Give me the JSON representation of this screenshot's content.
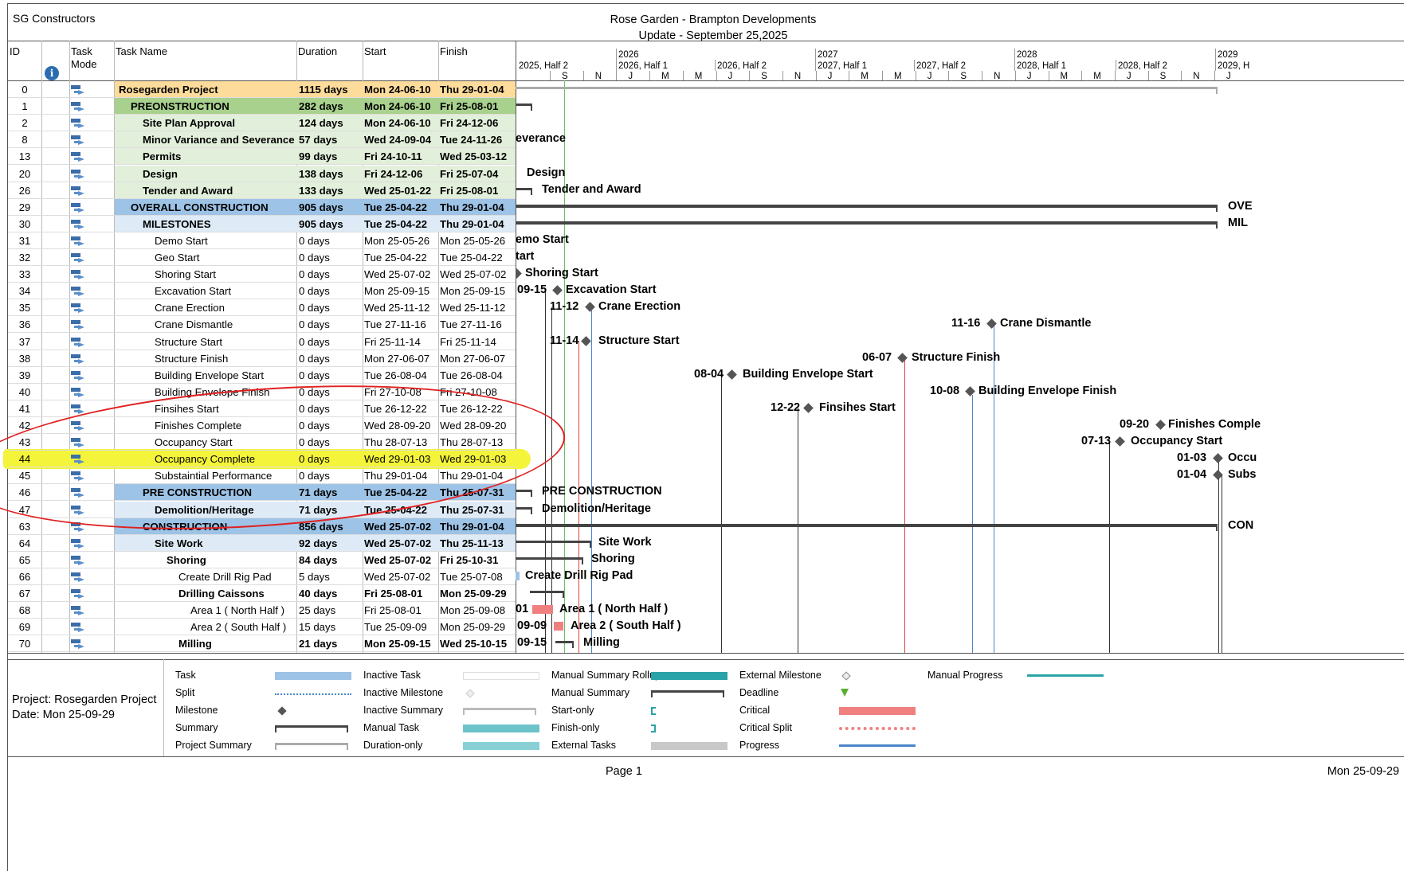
{
  "header": {
    "company": "SG Constructors",
    "title_line1": "Rose Garden - Brampton Developments",
    "title_line2": "Update - September 25,2025"
  },
  "columns": {
    "id": "ID",
    "indicator_icon": "info-icon",
    "task_mode_1": "Task",
    "task_mode_2": "Mode",
    "task_name": "Task Name",
    "duration": "Duration",
    "start": "Start",
    "finish": "Finish"
  },
  "timescale": {
    "years": [
      "2026",
      "2027",
      "2028",
      "2029"
    ],
    "halves": [
      "2025, Half 2",
      "2026, Half 1",
      "2026, Half 2",
      "2027, Half 1",
      "2027, Half 2",
      "2028, Half 1",
      "2028, Half 2",
      "2029, H"
    ],
    "months": [
      "S",
      "N",
      "J",
      "M",
      "M",
      "J",
      "S",
      "N",
      "J",
      "M",
      "M",
      "J",
      "S",
      "N",
      "J",
      "M",
      "M",
      "J",
      "S",
      "N",
      "J"
    ]
  },
  "rows": [
    {
      "id": "0",
      "name": "Rosegarden Project",
      "duration": "1115 days",
      "start": "Mon 24-06-10",
      "finish": "Thu 29-01-04",
      "bold": true,
      "indent": 0,
      "color": "#fddc9b"
    },
    {
      "id": "1",
      "name": "PREONSTRUCTION",
      "duration": "282 days",
      "start": "Mon 24-06-10",
      "finish": "Fri 25-08-01",
      "bold": true,
      "indent": 1,
      "color": "#a9d18e"
    },
    {
      "id": "2",
      "name": "Site Plan Approval",
      "duration": "124 days",
      "start": "Mon 24-06-10",
      "finish": "Fri 24-12-06",
      "bold": true,
      "indent": 2,
      "color": "#e2efda"
    },
    {
      "id": "8",
      "name": "Minor Variance and Severance",
      "duration": "57 days",
      "start": "Wed 24-09-04",
      "finish": "Tue 24-11-26",
      "bold": true,
      "indent": 2,
      "color": "#e2efda"
    },
    {
      "id": "13",
      "name": "Permits",
      "duration": "99 days",
      "start": "Fri 24-10-11",
      "finish": "Wed 25-03-12",
      "bold": true,
      "indent": 2,
      "color": "#e2efda"
    },
    {
      "id": "20",
      "name": "Design",
      "duration": "138 days",
      "start": "Fri 24-12-06",
      "finish": "Fri 25-07-04",
      "bold": true,
      "indent": 2,
      "color": "#e2efda"
    },
    {
      "id": "26",
      "name": "Tender and Award",
      "duration": "133 days",
      "start": "Wed 25-01-22",
      "finish": "Fri 25-08-01",
      "bold": true,
      "indent": 2,
      "color": "#e2efda"
    },
    {
      "id": "29",
      "name": "OVERALL CONSTRUCTION",
      "duration": "905 days",
      "start": "Tue 25-04-22",
      "finish": "Thu 29-01-04",
      "bold": true,
      "indent": 1,
      "color": "#9dc3e6"
    },
    {
      "id": "30",
      "name": "MILESTONES",
      "duration": "905 days",
      "start": "Tue 25-04-22",
      "finish": "Thu 29-01-04",
      "bold": true,
      "indent": 2,
      "color": "#deebf7"
    },
    {
      "id": "31",
      "name": "Demo Start",
      "duration": "0 days",
      "start": "Mon 25-05-26",
      "finish": "Mon 25-05-26",
      "bold": false,
      "indent": 3,
      "color": ""
    },
    {
      "id": "32",
      "name": "Geo Start",
      "duration": "0 days",
      "start": "Tue 25-04-22",
      "finish": "Tue 25-04-22",
      "bold": false,
      "indent": 3,
      "color": ""
    },
    {
      "id": "33",
      "name": "Shoring Start",
      "duration": "0 days",
      "start": "Wed 25-07-02",
      "finish": "Wed 25-07-02",
      "bold": false,
      "indent": 3,
      "color": ""
    },
    {
      "id": "34",
      "name": "Excavation Start",
      "duration": "0 days",
      "start": "Mon 25-09-15",
      "finish": "Mon 25-09-15",
      "bold": false,
      "indent": 3,
      "color": ""
    },
    {
      "id": "35",
      "name": "Crane Erection",
      "duration": "0 days",
      "start": "Wed 25-11-12",
      "finish": "Wed 25-11-12",
      "bold": false,
      "indent": 3,
      "color": ""
    },
    {
      "id": "36",
      "name": "Crane Dismantle",
      "duration": "0 days",
      "start": "Tue 27-11-16",
      "finish": "Tue 27-11-16",
      "bold": false,
      "indent": 3,
      "color": ""
    },
    {
      "id": "37",
      "name": "Structure Start",
      "duration": "0 days",
      "start": "Fri 25-11-14",
      "finish": "Fri 25-11-14",
      "bold": false,
      "indent": 3,
      "color": ""
    },
    {
      "id": "38",
      "name": "Structure Finish",
      "duration": "0 days",
      "start": "Mon 27-06-07",
      "finish": "Mon 27-06-07",
      "bold": false,
      "indent": 3,
      "color": ""
    },
    {
      "id": "39",
      "name": "Building Envelope Start",
      "duration": "0 days",
      "start": "Tue 26-08-04",
      "finish": "Tue 26-08-04",
      "bold": false,
      "indent": 3,
      "color": ""
    },
    {
      "id": "40",
      "name": "Building Envelope Finish",
      "duration": "0 days",
      "start": "Fri 27-10-08",
      "finish": "Fri 27-10-08",
      "bold": false,
      "indent": 3,
      "color": ""
    },
    {
      "id": "41",
      "name": "Finsihes Start",
      "duration": "0 days",
      "start": "Tue 26-12-22",
      "finish": "Tue 26-12-22",
      "bold": false,
      "indent": 3,
      "color": ""
    },
    {
      "id": "42",
      "name": "Finishes Complete",
      "duration": "0 days",
      "start": "Wed 28-09-20",
      "finish": "Wed 28-09-20",
      "bold": false,
      "indent": 3,
      "color": ""
    },
    {
      "id": "43",
      "name": "Occupancy Start",
      "duration": "0 days",
      "start": "Thu 28-07-13",
      "finish": "Thu 28-07-13",
      "bold": false,
      "indent": 3,
      "color": ""
    },
    {
      "id": "44",
      "name": "Occupancy Complete",
      "duration": "0 days",
      "start": "Wed 29-01-03",
      "finish": "Wed 29-01-03",
      "bold": false,
      "indent": 3,
      "color": ""
    },
    {
      "id": "45",
      "name": "Substaintial Performance",
      "duration": "0 days",
      "start": "Thu 29-01-04",
      "finish": "Thu 29-01-04",
      "bold": false,
      "indent": 3,
      "color": ""
    },
    {
      "id": "46",
      "name": "PRE CONSTRUCTION",
      "duration": "71 days",
      "start": "Tue 25-04-22",
      "finish": "Thu 25-07-31",
      "bold": true,
      "indent": 2,
      "color": "#9dc3e6"
    },
    {
      "id": "47",
      "name": "Demolition/Heritage",
      "duration": "71 days",
      "start": "Tue 25-04-22",
      "finish": "Thu 25-07-31",
      "bold": true,
      "indent": 3,
      "color": "#deebf7"
    },
    {
      "id": "63",
      "name": "CONSTRUCTION",
      "duration": "856 days",
      "start": "Wed 25-07-02",
      "finish": "Thu 29-01-04",
      "bold": true,
      "indent": 2,
      "color": "#9dc3e6"
    },
    {
      "id": "64",
      "name": "Site Work",
      "duration": "92 days",
      "start": "Wed 25-07-02",
      "finish": "Thu 25-11-13",
      "bold": true,
      "indent": 3,
      "color": "#deebf7"
    },
    {
      "id": "65",
      "name": "Shoring",
      "duration": "84 days",
      "start": "Wed 25-07-02",
      "finish": "Fri 25-10-31",
      "bold": true,
      "indent": 4,
      "color": ""
    },
    {
      "id": "66",
      "name": "Create Drill Rig Pad",
      "duration": "5 days",
      "start": "Wed 25-07-02",
      "finish": "Tue 25-07-08",
      "bold": false,
      "indent": 5,
      "color": ""
    },
    {
      "id": "67",
      "name": "Drilling Caissons",
      "duration": "40 days",
      "start": "Fri 25-08-01",
      "finish": "Mon 25-09-29",
      "bold": true,
      "indent": 5,
      "color": ""
    },
    {
      "id": "68",
      "name": "Area 1 ( North Half )",
      "duration": "25 days",
      "start": "Fri 25-08-01",
      "finish": "Mon 25-09-08",
      "bold": false,
      "indent": 6,
      "color": ""
    },
    {
      "id": "69",
      "name": "Area 2 ( South Half )",
      "duration": "15 days",
      "start": "Tue 25-09-09",
      "finish": "Mon 25-09-29",
      "bold": false,
      "indent": 6,
      "color": ""
    },
    {
      "id": "70",
      "name": "Milling",
      "duration": "21 days",
      "start": "Mon 25-09-15",
      "finish": "Wed 25-10-15",
      "bold": true,
      "indent": 5,
      "color": ""
    }
  ],
  "chart_labels": [
    {
      "row": 3,
      "text": "everance"
    },
    {
      "row": 5,
      "text": "Design"
    },
    {
      "row": 6,
      "text": "Tender and Award"
    },
    {
      "row": 7,
      "text": "OVE"
    },
    {
      "row": 8,
      "text": "MIL"
    },
    {
      "row": 9,
      "text": "emo Start"
    },
    {
      "row": 10,
      "text": "tart"
    },
    {
      "row": 11,
      "text": "Shoring Start"
    },
    {
      "row": 12,
      "text": "09-15",
      "text2": "Excavation Start"
    },
    {
      "row": 13,
      "text": "11-12",
      "text2": "Crane Erection"
    },
    {
      "row": 14,
      "text": "11-16",
      "text2": "Crane Dismantle"
    },
    {
      "row": 15,
      "text": "11-14",
      "text2": "Structure Start"
    },
    {
      "row": 16,
      "text": "06-07",
      "text2": "Structure Finish"
    },
    {
      "row": 17,
      "text": "08-04",
      "text2": "Building Envelope Start"
    },
    {
      "row": 18,
      "text": "10-08",
      "text2": "Building Envelope Finish"
    },
    {
      "row": 19,
      "text": "12-22",
      "text2": "Finsihes Start"
    },
    {
      "row": 20,
      "text": "09-20",
      "text2": "Finishes Comple"
    },
    {
      "row": 21,
      "text": "07-13",
      "text2": "Occupancy Start"
    },
    {
      "row": 22,
      "text": "01-03",
      "text2": "Occu"
    },
    {
      "row": 23,
      "text": "01-04",
      "text2": "Subs"
    },
    {
      "row": 24,
      "text": "PRE CONSTRUCTION"
    },
    {
      "row": 25,
      "text": "Demolition/Heritage"
    },
    {
      "row": 26,
      "text": "CON"
    },
    {
      "row": 27,
      "text": "Site Work"
    },
    {
      "row": 28,
      "text": "Shoring"
    },
    {
      "row": 29,
      "text": "Create Drill Rig Pad"
    },
    {
      "row": 31,
      "text": "01",
      "text2": "Area 1 ( North Half )"
    },
    {
      "row": 32,
      "text": "09-09",
      "text2": "Area 2 ( South Half )"
    },
    {
      "row": 33,
      "text": "09-15",
      "text2": "Milling"
    }
  ],
  "legend": {
    "project": "Project: Rosegarden Project",
    "date": "Date: Mon 25-09-29",
    "col1": [
      "Task",
      "Split",
      "Milestone",
      "Summary",
      "Project Summary"
    ],
    "col2": [
      "Inactive Task",
      "Inactive Milestone",
      "Inactive Summary",
      "Manual Task",
      "Duration-only"
    ],
    "col3": [
      "Manual Summary Rollup",
      "Manual Summary",
      "Start-only",
      "Finish-only",
      "External Tasks"
    ],
    "col4": [
      "External Milestone",
      "Deadline",
      "Critical",
      "Critical Split",
      "Progress"
    ],
    "col5": [
      "Manual Progress"
    ]
  },
  "footer": {
    "page": "Page 1",
    "date": "Mon 25-09-29"
  },
  "colors": {
    "task_blue": "#9dc3e6",
    "critical": "#f08080",
    "progress": "#4a86c8",
    "highlight": "#f4f43a",
    "annotation_circle": "#e02020",
    "status_line": "#6abf69"
  }
}
